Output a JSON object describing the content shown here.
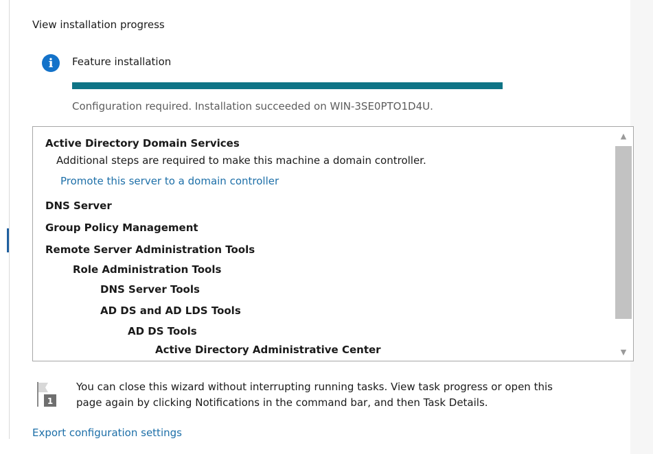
{
  "wizard": {
    "heading": "View installation progress",
    "feature_label": "Feature installation",
    "progress": 1.0,
    "status": "Configuration required. Installation succeeded on WIN-3SE0PTO1D4U."
  },
  "results": {
    "items": [
      {
        "text": "Active Directory Domain Services",
        "bold": true
      },
      {
        "text": "Additional steps are required to make this machine a domain controller.",
        "bold": false
      },
      {
        "text": "Promote this server to a domain controller",
        "link": true
      },
      {
        "text": "DNS Server",
        "bold": true
      },
      {
        "text": "Group Policy Management",
        "bold": true
      },
      {
        "text": "Remote Server Administration Tools",
        "bold": true
      },
      {
        "text": "Role Administration Tools",
        "bold": true
      },
      {
        "text": "DNS Server Tools",
        "bold": true
      },
      {
        "text": "AD DS and AD LDS Tools",
        "bold": true
      },
      {
        "text": "AD DS Tools",
        "bold": true
      },
      {
        "text": "Active Directory Administrative Center",
        "bold": true
      }
    ]
  },
  "note": {
    "line1": "You can close this wizard without interrupting running tasks. View task progress or open this",
    "line2": "page again by clicking Notifications in the command bar, and then Task Details.",
    "flag_badge": "1"
  },
  "export_link": "Export configuration settings",
  "icons": {
    "info": "info-icon",
    "flag": "notification-flag-icon",
    "scroll_up": "chevron-up-icon",
    "scroll_down": "chevron-down-icon"
  },
  "colors": {
    "progress": "#0f7486",
    "link": "#1d6fa8",
    "info": "#1372c9"
  }
}
